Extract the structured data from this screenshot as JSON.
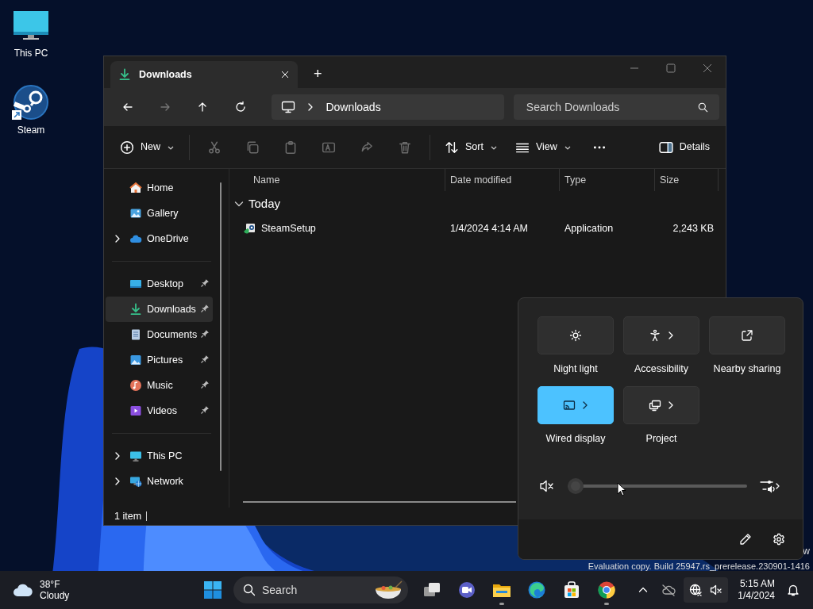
{
  "desktop_icons": [
    {
      "label": "This PC",
      "kind": "pc"
    },
    {
      "label": "Steam",
      "kind": "steam"
    }
  ],
  "explorer": {
    "tabs": [
      {
        "label": "Downloads",
        "kind": "downloads",
        "selected": true
      }
    ],
    "new_tab": "+",
    "nav": [
      {
        "kind": "back",
        "disabled": false
      },
      {
        "kind": "forward",
        "disabled": true
      },
      {
        "kind": "up",
        "disabled": false
      },
      {
        "kind": "refresh",
        "disabled": false
      }
    ],
    "address": {
      "path": "Downloads"
    },
    "search": {
      "placeholder": "Search Downloads"
    },
    "toolbar": [
      {
        "kind": "new",
        "label": "New"
      },
      {
        "kind": "separator"
      },
      {
        "kind": "cut",
        "disabled": true
      },
      {
        "kind": "copy",
        "disabled": true
      },
      {
        "kind": "paste",
        "disabled": true
      },
      {
        "kind": "rename",
        "disabled": true
      },
      {
        "kind": "share",
        "disabled": true
      },
      {
        "kind": "delete",
        "disabled": true
      },
      {
        "kind": "separator"
      },
      {
        "kind": "sort",
        "label": "Sort"
      },
      {
        "kind": "view",
        "label": "View"
      },
      {
        "kind": "more",
        "disabled": false
      },
      {
        "kind": "details",
        "label": "Details"
      }
    ],
    "sidebar": [
      {
        "items": [
          {
            "label": "Home",
            "kind": "home",
            "expandable": false,
            "pinned": false,
            "selected": false
          },
          {
            "label": "Gallery",
            "kind": "gallery",
            "expandable": false,
            "pinned": false,
            "selected": false
          },
          {
            "label": "OneDrive",
            "kind": "cloud",
            "expandable": true,
            "pinned": false,
            "selected": false
          }
        ]
      },
      {
        "items": [
          {
            "label": "Desktop",
            "kind": "desktop",
            "expandable": false,
            "pinned": true,
            "selected": false
          },
          {
            "label": "Downloads",
            "kind": "downloads",
            "expandable": false,
            "pinned": true,
            "selected": true
          },
          {
            "label": "Documents",
            "kind": "documents",
            "expandable": false,
            "pinned": true,
            "selected": false
          },
          {
            "label": "Pictures",
            "kind": "pictures",
            "expandable": false,
            "pinned": true,
            "selected": false
          },
          {
            "label": "Music",
            "kind": "music",
            "expandable": false,
            "pinned": true,
            "selected": false
          },
          {
            "label": "Videos",
            "kind": "videos",
            "expandable": false,
            "pinned": true,
            "selected": false
          }
        ]
      },
      {
        "items": [
          {
            "label": "This PC",
            "kind": "pc",
            "expandable": true,
            "pinned": false,
            "selected": false
          },
          {
            "label": "Network",
            "kind": "network",
            "expandable": true,
            "pinned": false,
            "selected": false
          }
        ]
      }
    ],
    "columns": [
      "Name",
      "Date modified",
      "Type",
      "Size"
    ],
    "groups": [
      {
        "label": "Today",
        "expanded": true,
        "rows": [
          {
            "name": "SteamSetup",
            "date_modified": "1/4/2024 4:14 AM",
            "type": "Application",
            "size": "2,243 KB"
          }
        ]
      }
    ],
    "status_bar": "1 item"
  },
  "quick_settings": {
    "tiles": [
      {
        "label": "Night light",
        "kind": "sun",
        "on": false,
        "has_menu": false
      },
      {
        "label": "Accessibility",
        "kind": "person",
        "on": false,
        "has_menu": true
      },
      {
        "label": "Nearby sharing",
        "kind": "share",
        "on": false,
        "has_menu": false
      },
      {
        "label": "Wired display",
        "kind": "cast",
        "on": true,
        "has_menu": true
      },
      {
        "label": "Project",
        "kind": "project",
        "on": false,
        "has_menu": true
      }
    ],
    "volume": {
      "muted": true,
      "level": 0
    }
  },
  "system_text": [
    "w",
    "Evaluation copy. Build 25947.rs_prerelease.230901-1416"
  ],
  "taskbar": {
    "weather": {
      "temperature": "38°F",
      "condition": "Cloudy"
    },
    "search": {
      "placeholder": "Search"
    },
    "apps": [
      {
        "kind": "taskview",
        "running": false
      },
      {
        "kind": "meet",
        "running": false
      },
      {
        "kind": "explorer",
        "running": true
      },
      {
        "kind": "edge",
        "running": false
      },
      {
        "kind": "store",
        "running": false
      },
      {
        "kind": "chrome",
        "running": true
      }
    ],
    "time": "5:15 AM",
    "date": "1/4/2024"
  }
}
